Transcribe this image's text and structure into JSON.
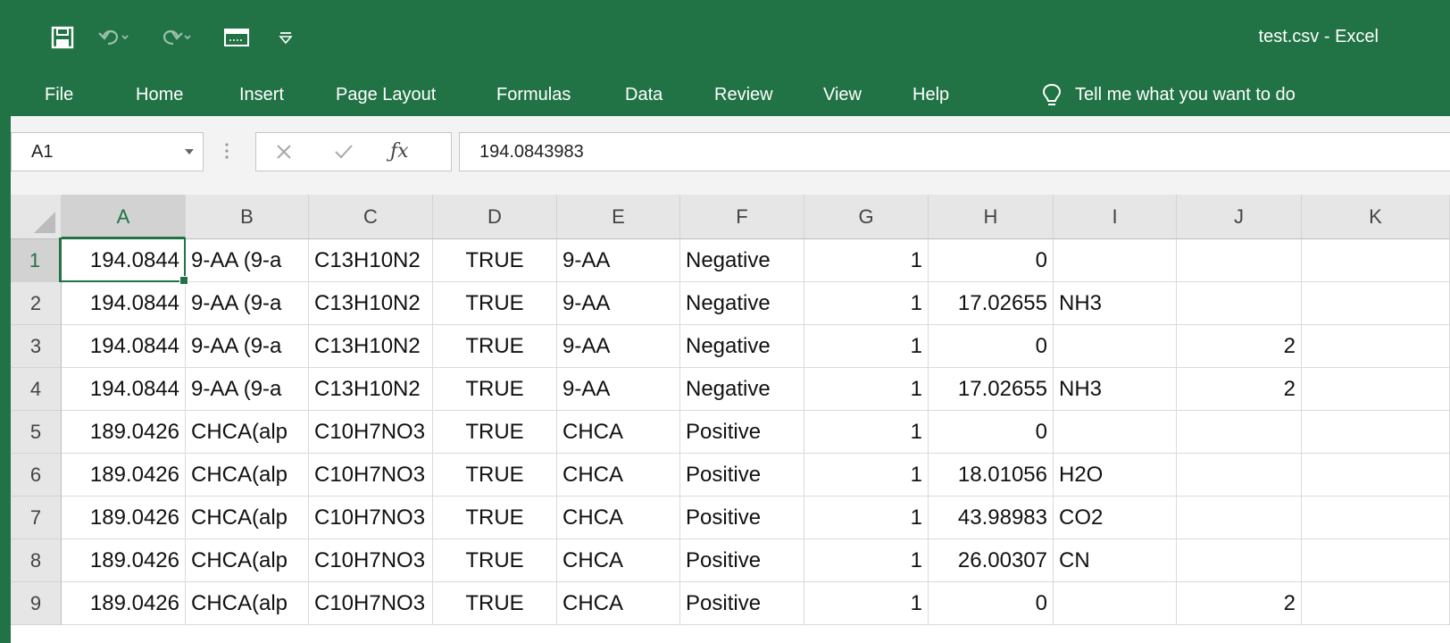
{
  "window": {
    "title": "test.csv  -  Excel"
  },
  "ribbon": {
    "tabs": [
      "File",
      "Home",
      "Insert",
      "Page Layout",
      "Formulas",
      "Data",
      "Review",
      "View",
      "Help"
    ],
    "tell_me": "Tell me what you want to do"
  },
  "formula_bar": {
    "name_box": "A1",
    "formula": "194.0843983"
  },
  "grid": {
    "columns": [
      "A",
      "B",
      "C",
      "D",
      "E",
      "F",
      "G",
      "H",
      "I",
      "J",
      "K"
    ],
    "rows": [
      {
        "n": "1",
        "cells": [
          "194.0844",
          "9-AA (9-a",
          "C13H10N2",
          "TRUE",
          "9-AA",
          "Negative",
          "1",
          "0",
          "",
          "",
          ""
        ]
      },
      {
        "n": "2",
        "cells": [
          "194.0844",
          "9-AA (9-a",
          "C13H10N2",
          "TRUE",
          "9-AA",
          "Negative",
          "1",
          "17.02655",
          "NH3",
          "",
          ""
        ]
      },
      {
        "n": "3",
        "cells": [
          "194.0844",
          "9-AA (9-a",
          "C13H10N2",
          "TRUE",
          "9-AA",
          "Negative",
          "1",
          "0",
          "",
          "2",
          ""
        ]
      },
      {
        "n": "4",
        "cells": [
          "194.0844",
          "9-AA (9-a",
          "C13H10N2",
          "TRUE",
          "9-AA",
          "Negative",
          "1",
          "17.02655",
          "NH3",
          "2",
          ""
        ]
      },
      {
        "n": "5",
        "cells": [
          "189.0426",
          "CHCA(alp",
          "C10H7NO3",
          "TRUE",
          "CHCA",
          "Positive",
          "1",
          "0",
          "",
          "",
          ""
        ]
      },
      {
        "n": "6",
        "cells": [
          "189.0426",
          "CHCA(alp",
          "C10H7NO3",
          "TRUE",
          "CHCA",
          "Positive",
          "1",
          "18.01056",
          "H2O",
          "",
          ""
        ]
      },
      {
        "n": "7",
        "cells": [
          "189.0426",
          "CHCA(alp",
          "C10H7NO3",
          "TRUE",
          "CHCA",
          "Positive",
          "1",
          "43.98983",
          "CO2",
          "",
          ""
        ]
      },
      {
        "n": "8",
        "cells": [
          "189.0426",
          "CHCA(alp",
          "C10H7NO3",
          "TRUE",
          "CHCA",
          "Positive",
          "1",
          "26.00307",
          "CN",
          "",
          ""
        ]
      },
      {
        "n": "9",
        "cells": [
          "189.0426",
          "CHCA(alp",
          "C10H7NO3",
          "TRUE",
          "CHCA",
          "Positive",
          "1",
          "0",
          "",
          "2",
          ""
        ]
      }
    ]
  },
  "theme": {
    "accent": "#217346"
  },
  "icons": {
    "quick_access": [
      "save-icon",
      "undo-icon",
      "redo-icon",
      "form-icon",
      "customize-toolbar-icon"
    ],
    "formula_bar": [
      "cancel-icon",
      "enter-icon",
      "function-icon"
    ],
    "tell_me": "lightbulb-icon"
  }
}
